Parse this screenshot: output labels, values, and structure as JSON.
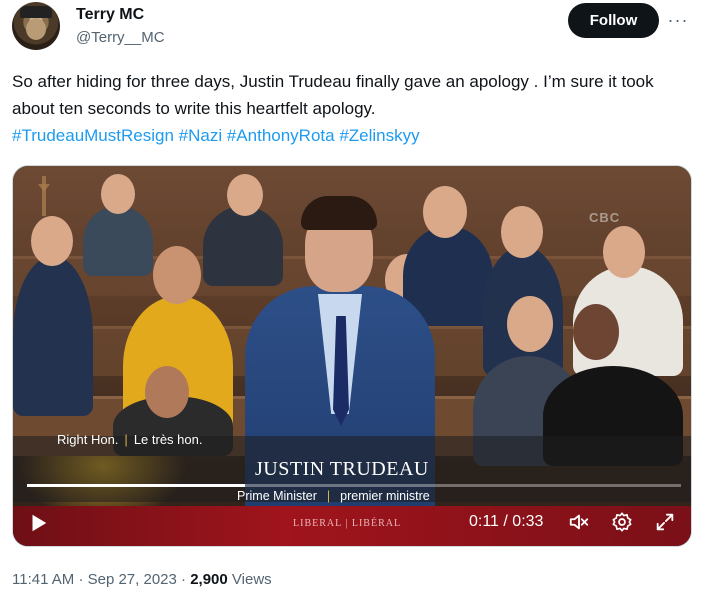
{
  "author": {
    "display_name": "Terry MC",
    "handle": "@Terry__MC"
  },
  "actions": {
    "follow_label": "Follow",
    "more_label": "···"
  },
  "tweet": {
    "text": "So after hiding for three days, Justin Trudeau finally gave an apology . I’m sure it took about ten seconds to write this heartfelt apology.",
    "hashtags": [
      "#TrudeauMustResign",
      "#Nazi",
      "#AnthonyRota",
      "#Zelinskyy"
    ]
  },
  "video": {
    "caption_en": "Right Hon.",
    "caption_sep": "|",
    "caption_fr": "Le très hon.",
    "speaker_name": "JUSTIN TRUDEAU",
    "title_en": "Prime Minister",
    "title_sep": "|",
    "title_fr": "premier ministre",
    "party_label": "LIBERAL | LIBÉRAL",
    "broadcaster_logo": "CBC",
    "elapsed": "0:11",
    "duration": "0:33",
    "time_readout": "0:11 / 0:33",
    "progress_fraction": 0.333,
    "accent_color": "#a0141c"
  },
  "meta": {
    "time": "11:41 AM",
    "separator": "·",
    "date": "Sep 27, 2023",
    "views_count": "2,900",
    "views_label": "Views"
  }
}
